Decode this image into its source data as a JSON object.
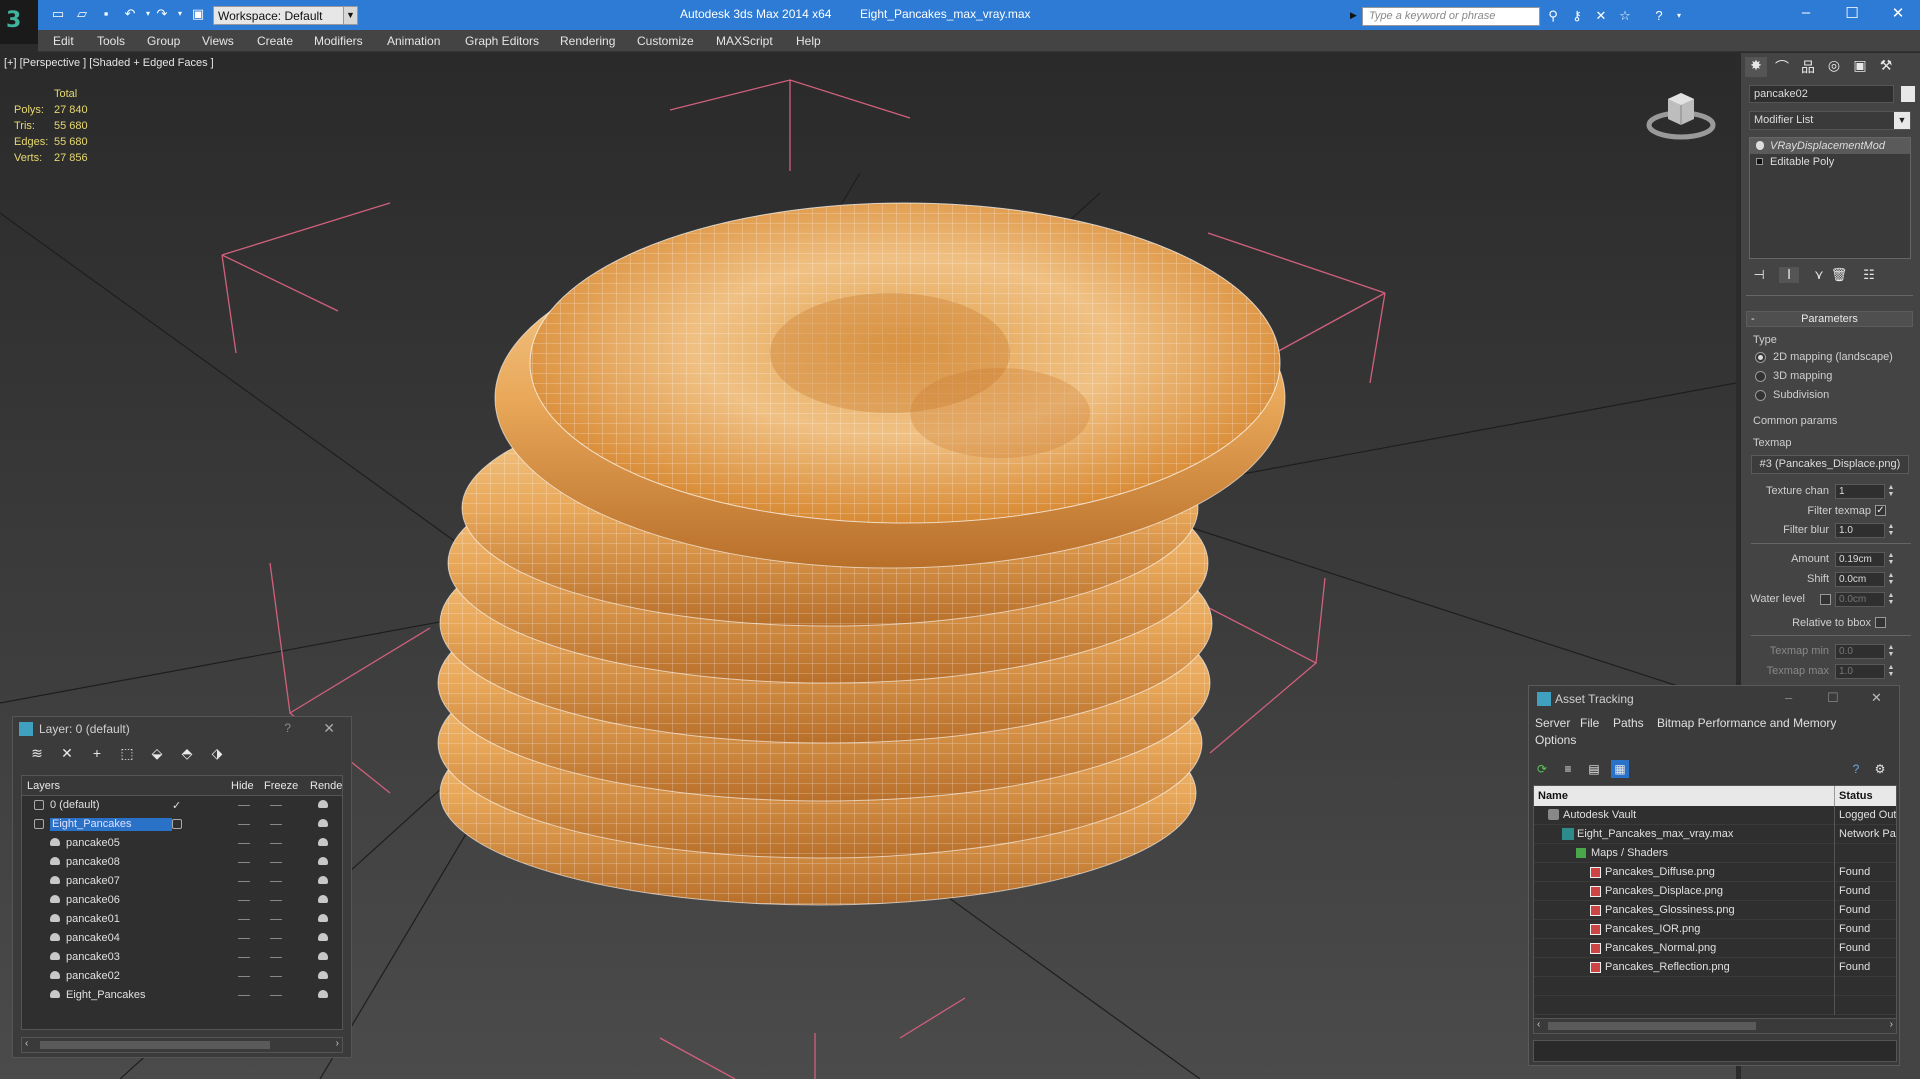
{
  "app": {
    "title": "Autodesk 3ds Max  2014 x64",
    "file": "Eight_Pancakes_max_vray.max",
    "logo_glyph": "3",
    "workspace": "Workspace: Default",
    "search_placeholder": "Type a keyword or phrase",
    "window_controls": {
      "minimize": "–",
      "maximize": "☐",
      "close": "✕"
    }
  },
  "menu": [
    "Edit",
    "Tools",
    "Group",
    "Views",
    "Create",
    "Modifiers",
    "Animation",
    "Graph Editors",
    "Rendering",
    "Customize",
    "MAXScript",
    "Help"
  ],
  "viewport": {
    "label": "[+] [Perspective ] [Shaded + Edged Faces ]",
    "stats_header": "Total",
    "stats": [
      {
        "k": "Polys:",
        "v": "27 840"
      },
      {
        "k": "Tris:",
        "v": "55 680"
      },
      {
        "k": "Edges:",
        "v": "55 680"
      },
      {
        "k": "Verts:",
        "v": "27 856"
      }
    ],
    "colors": {
      "bg_top": "#2b2b2b",
      "bg_bottom": "#4a4a4a",
      "bracket": "#d0607c",
      "pancake": "#e8b26a",
      "pancake_dark": "#c77a2a"
    }
  },
  "layer_window": {
    "title": "Layer: 0 (default)",
    "help": "?",
    "close": "✕",
    "columns": {
      "layers": "Layers",
      "hide": "Hide",
      "freeze": "Freeze",
      "render": "Rende"
    },
    "rows": [
      {
        "name": "0 (default)",
        "indent": 0,
        "kind": "layer",
        "check": "✓"
      },
      {
        "name": "Eight_Pancakes",
        "indent": 0,
        "kind": "layer",
        "selected": true
      },
      {
        "name": "pancake05",
        "indent": 1,
        "kind": "object"
      },
      {
        "name": "pancake08",
        "indent": 1,
        "kind": "object"
      },
      {
        "name": "pancake07",
        "indent": 1,
        "kind": "object"
      },
      {
        "name": "pancake06",
        "indent": 1,
        "kind": "object"
      },
      {
        "name": "pancake01",
        "indent": 1,
        "kind": "object"
      },
      {
        "name": "pancake04",
        "indent": 1,
        "kind": "object"
      },
      {
        "name": "pancake03",
        "indent": 1,
        "kind": "object"
      },
      {
        "name": "pancake02",
        "indent": 1,
        "kind": "object"
      },
      {
        "name": "Eight_Pancakes",
        "indent": 1,
        "kind": "object"
      }
    ]
  },
  "command_panel": {
    "object_name": "pancake02",
    "modifier_list": "Modifier List",
    "stack": [
      {
        "label": "VRayDisplacementMod",
        "selected": true
      },
      {
        "label": "Editable Poly",
        "selected": false
      }
    ],
    "parameters_title": "Parameters",
    "type_label": "Type",
    "type_options": [
      {
        "label": "2D mapping (landscape)",
        "selected": true
      },
      {
        "label": "3D mapping",
        "selected": false
      },
      {
        "label": "Subdivision",
        "selected": false
      }
    ],
    "common_params": "Common params",
    "texmap_label": "Texmap",
    "texmap_value": "#3 (Pancakes_Displace.png)",
    "texture_chan_label": "Texture chan",
    "texture_chan": "1",
    "filter_texmap_label": "Filter texmap",
    "filter_texmap_checked": true,
    "filter_blur_label": "Filter blur",
    "filter_blur": "1.0",
    "amount_label": "Amount",
    "amount": "0.19cm",
    "shift_label": "Shift",
    "shift": "0.0cm",
    "water_level_label": "Water level",
    "water_level": "0.0cm",
    "relative_bbox_label": "Relative to bbox",
    "texmap_min_label": "Texmap min",
    "texmap_min": "0.0",
    "texmap_max_label": "Texmap max",
    "texmap_max": "1.0"
  },
  "asset_tracking": {
    "title": "Asset Tracking",
    "menu": [
      "Server",
      "File",
      "Paths",
      "Bitmap Performance and Memory",
      "Options"
    ],
    "columns": {
      "name": "Name",
      "status": "Status"
    },
    "rows": [
      {
        "name": "Autodesk Vault",
        "indent": 1,
        "kind": "vault",
        "status": "Logged Out"
      },
      {
        "name": "Eight_Pancakes_max_vray.max",
        "indent": 2,
        "kind": "max",
        "status": "Network Path"
      },
      {
        "name": "Maps / Shaders",
        "indent": 3,
        "kind": "folder",
        "status": ""
      },
      {
        "name": "Pancakes_Diffuse.png",
        "indent": 4,
        "kind": "png",
        "status": "Found"
      },
      {
        "name": "Pancakes_Displace.png",
        "indent": 4,
        "kind": "png",
        "status": "Found"
      },
      {
        "name": "Pancakes_Glossiness.png",
        "indent": 4,
        "kind": "png",
        "status": "Found"
      },
      {
        "name": "Pancakes_IOR.png",
        "indent": 4,
        "kind": "png",
        "status": "Found"
      },
      {
        "name": "Pancakes_Normal.png",
        "indent": 4,
        "kind": "png",
        "status": "Found"
      },
      {
        "name": "Pancakes_Reflection.png",
        "indent": 4,
        "kind": "png",
        "status": "Found"
      }
    ]
  }
}
